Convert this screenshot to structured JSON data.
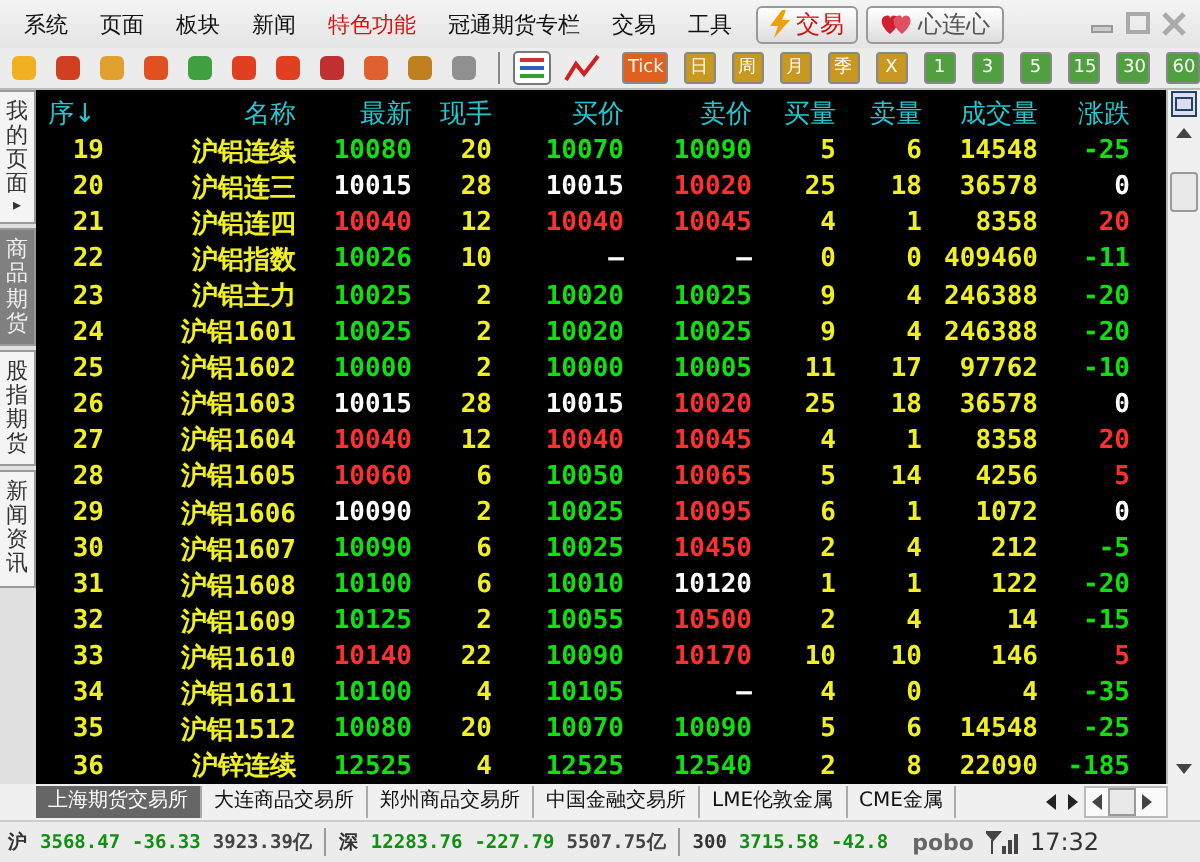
{
  "menu": [
    {
      "label": "系统",
      "highlighted": false
    },
    {
      "label": "页面",
      "highlighted": false
    },
    {
      "label": "板块",
      "highlighted": false
    },
    {
      "label": "新闻",
      "highlighted": false
    },
    {
      "label": "特色功能",
      "highlighted": true
    },
    {
      "label": "冠通期货专栏",
      "highlighted": false
    },
    {
      "label": "交易",
      "highlighted": false
    },
    {
      "label": "工具",
      "highlighted": false
    }
  ],
  "trade_button": "交易",
  "heart_button": "心连心",
  "period_buttons": [
    {
      "label": "Tick",
      "kind": "tick"
    },
    {
      "label": "日",
      "kind": "period"
    },
    {
      "label": "周",
      "kind": "period"
    },
    {
      "label": "月",
      "kind": "period"
    },
    {
      "label": "季",
      "kind": "period"
    },
    {
      "label": "X",
      "kind": "period"
    },
    {
      "label": "1",
      "kind": "minute"
    },
    {
      "label": "3",
      "kind": "minute"
    },
    {
      "label": "5",
      "kind": "minute"
    },
    {
      "label": "15",
      "kind": "minute"
    },
    {
      "label": "30",
      "kind": "minute"
    },
    {
      "label": "60",
      "kind": "minute"
    }
  ],
  "side_tabs": [
    {
      "label": "我的页面",
      "selected": false,
      "arrow": "▸"
    },
    {
      "label": "商品期货",
      "selected": true
    },
    {
      "label": "股指期货",
      "selected": false
    },
    {
      "label": "新闻资讯",
      "selected": false
    }
  ],
  "table": {
    "columns": [
      "序↓",
      "名称",
      "最新",
      "现手",
      "买价",
      "卖价",
      "买量",
      "卖量",
      "成交量",
      "涨跌"
    ],
    "rows": [
      {
        "no": "19",
        "name": "沪铝连续",
        "last": {
          "text": "10080",
          "color": "#10e010"
        },
        "hand": "20",
        "bid": {
          "text": "10070",
          "color": "#10e010"
        },
        "ask": {
          "text": "10090",
          "color": "#10e010"
        },
        "bid_qty": "5",
        "ask_qty": "6",
        "volume": "14548",
        "change": {
          "text": "-25",
          "color": "#10e010"
        }
      },
      {
        "no": "20",
        "name": "沪铝连三",
        "last": {
          "text": "10015",
          "color": "#ffffff"
        },
        "hand": "28",
        "bid": {
          "text": "10015",
          "color": "#ffffff"
        },
        "ask": {
          "text": "10020",
          "color": "#ff3030"
        },
        "bid_qty": "25",
        "ask_qty": "18",
        "volume": "36578",
        "change": {
          "text": "0",
          "color": "#ffffff"
        }
      },
      {
        "no": "21",
        "name": "沪铝连四",
        "last": {
          "text": "10040",
          "color": "#ff3030"
        },
        "hand": "12",
        "bid": {
          "text": "10040",
          "color": "#ff3030"
        },
        "ask": {
          "text": "10045",
          "color": "#ff3030"
        },
        "bid_qty": "4",
        "ask_qty": "1",
        "volume": "8358",
        "change": {
          "text": "20",
          "color": "#ff3030"
        }
      },
      {
        "no": "22",
        "name": "沪铝指数",
        "last": {
          "text": "10026",
          "color": "#10e010"
        },
        "hand": "10",
        "bid": {
          "text": "—",
          "color": "#ffffff"
        },
        "ask": {
          "text": "—",
          "color": "#ffffff"
        },
        "bid_qty": "0",
        "ask_qty": "0",
        "volume": "409460",
        "change": {
          "text": "-11",
          "color": "#10e010"
        }
      },
      {
        "no": "23",
        "name": "沪铝主力",
        "last": {
          "text": "10025",
          "color": "#10e010"
        },
        "hand": "2",
        "bid": {
          "text": "10020",
          "color": "#10e010"
        },
        "ask": {
          "text": "10025",
          "color": "#10e010"
        },
        "bid_qty": "9",
        "ask_qty": "4",
        "volume": "246388",
        "change": {
          "text": "-20",
          "color": "#10e010"
        }
      },
      {
        "no": "24",
        "name": "沪铝1601",
        "last": {
          "text": "10025",
          "color": "#10e010"
        },
        "hand": "2",
        "bid": {
          "text": "10020",
          "color": "#10e010"
        },
        "ask": {
          "text": "10025",
          "color": "#10e010"
        },
        "bid_qty": "9",
        "ask_qty": "4",
        "volume": "246388",
        "change": {
          "text": "-20",
          "color": "#10e010"
        }
      },
      {
        "no": "25",
        "name": "沪铝1602",
        "last": {
          "text": "10000",
          "color": "#10e010"
        },
        "hand": "2",
        "bid": {
          "text": "10000",
          "color": "#10e010"
        },
        "ask": {
          "text": "10005",
          "color": "#10e010"
        },
        "bid_qty": "11",
        "ask_qty": "17",
        "volume": "97762",
        "change": {
          "text": "-10",
          "color": "#10e010"
        }
      },
      {
        "no": "26",
        "name": "沪铝1603",
        "last": {
          "text": "10015",
          "color": "#ffffff"
        },
        "hand": "28",
        "bid": {
          "text": "10015",
          "color": "#ffffff"
        },
        "ask": {
          "text": "10020",
          "color": "#ff3030"
        },
        "bid_qty": "25",
        "ask_qty": "18",
        "volume": "36578",
        "change": {
          "text": "0",
          "color": "#ffffff"
        }
      },
      {
        "no": "27",
        "name": "沪铝1604",
        "last": {
          "text": "10040",
          "color": "#ff3030"
        },
        "hand": "12",
        "bid": {
          "text": "10040",
          "color": "#ff3030"
        },
        "ask": {
          "text": "10045",
          "color": "#ff3030"
        },
        "bid_qty": "4",
        "ask_qty": "1",
        "volume": "8358",
        "change": {
          "text": "20",
          "color": "#ff3030"
        }
      },
      {
        "no": "28",
        "name": "沪铝1605",
        "last": {
          "text": "10060",
          "color": "#ff3030"
        },
        "hand": "6",
        "bid": {
          "text": "10050",
          "color": "#10e010"
        },
        "ask": {
          "text": "10065",
          "color": "#ff3030"
        },
        "bid_qty": "5",
        "ask_qty": "14",
        "volume": "4256",
        "change": {
          "text": "5",
          "color": "#ff3030"
        }
      },
      {
        "no": "29",
        "name": "沪铝1606",
        "last": {
          "text": "10090",
          "color": "#ffffff"
        },
        "hand": "2",
        "bid": {
          "text": "10025",
          "color": "#10e010"
        },
        "ask": {
          "text": "10095",
          "color": "#ff3030"
        },
        "bid_qty": "6",
        "ask_qty": "1",
        "volume": "1072",
        "change": {
          "text": "0",
          "color": "#ffffff"
        }
      },
      {
        "no": "30",
        "name": "沪铝1607",
        "last": {
          "text": "10090",
          "color": "#10e010"
        },
        "hand": "6",
        "bid": {
          "text": "10025",
          "color": "#10e010"
        },
        "ask": {
          "text": "10450",
          "color": "#ff3030"
        },
        "bid_qty": "2",
        "ask_qty": "4",
        "volume": "212",
        "change": {
          "text": "-5",
          "color": "#10e010"
        }
      },
      {
        "no": "31",
        "name": "沪铝1608",
        "last": {
          "text": "10100",
          "color": "#10e010"
        },
        "hand": "6",
        "bid": {
          "text": "10010",
          "color": "#10e010"
        },
        "ask": {
          "text": "10120",
          "color": "#ffffff"
        },
        "bid_qty": "1",
        "ask_qty": "1",
        "volume": "122",
        "change": {
          "text": "-20",
          "color": "#10e010"
        }
      },
      {
        "no": "32",
        "name": "沪铝1609",
        "last": {
          "text": "10125",
          "color": "#10e010"
        },
        "hand": "2",
        "bid": {
          "text": "10055",
          "color": "#10e010"
        },
        "ask": {
          "text": "10500",
          "color": "#ff3030"
        },
        "bid_qty": "2",
        "ask_qty": "4",
        "volume": "14",
        "change": {
          "text": "-15",
          "color": "#10e010"
        }
      },
      {
        "no": "33",
        "name": "沪铝1610",
        "last": {
          "text": "10140",
          "color": "#ff3030"
        },
        "hand": "22",
        "bid": {
          "text": "10090",
          "color": "#10e010"
        },
        "ask": {
          "text": "10170",
          "color": "#ff3030"
        },
        "bid_qty": "10",
        "ask_qty": "10",
        "volume": "146",
        "change": {
          "text": "5",
          "color": "#ff3030"
        }
      },
      {
        "no": "34",
        "name": "沪铝1611",
        "last": {
          "text": "10100",
          "color": "#10e010"
        },
        "hand": "4",
        "bid": {
          "text": "10105",
          "color": "#10e010"
        },
        "ask": {
          "text": "—",
          "color": "#ffffff"
        },
        "bid_qty": "4",
        "ask_qty": "0",
        "volume": "4",
        "change": {
          "text": "-35",
          "color": "#10e010"
        }
      },
      {
        "no": "35",
        "name": "沪铝1512",
        "last": {
          "text": "10080",
          "color": "#10e010"
        },
        "hand": "20",
        "bid": {
          "text": "10070",
          "color": "#10e010"
        },
        "ask": {
          "text": "10090",
          "color": "#10e010"
        },
        "bid_qty": "5",
        "ask_qty": "6",
        "volume": "14548",
        "change": {
          "text": "-25",
          "color": "#10e010"
        }
      },
      {
        "no": "36",
        "name": "沪锌连续",
        "last": {
          "text": "12525",
          "color": "#10e010"
        },
        "hand": "4",
        "bid": {
          "text": "12525",
          "color": "#10e010"
        },
        "ask": {
          "text": "12540",
          "color": "#10e010"
        },
        "bid_qty": "2",
        "ask_qty": "8",
        "volume": "22090",
        "change": {
          "text": "-185",
          "color": "#10e010"
        }
      }
    ]
  },
  "exchange_tabs": [
    {
      "label": "上海期货交易所",
      "selected": true
    },
    {
      "label": "大连商品交易所",
      "selected": false
    },
    {
      "label": "郑州商品交易所",
      "selected": false
    },
    {
      "label": "中国金融交易所",
      "selected": false
    },
    {
      "label": "LME伦敦金属",
      "selected": false
    },
    {
      "label": "CME金属",
      "selected": false
    }
  ],
  "status_bar": {
    "indices": [
      {
        "label": "沪",
        "value": "3568.47",
        "change": "-36.33",
        "amount": "3923.39亿"
      },
      {
        "label": "深",
        "value": "12283.76",
        "change": "-227.79",
        "amount": "5507.75亿"
      },
      {
        "label": "300",
        "value": "3715.58",
        "change": "-42.8"
      }
    ],
    "brand": "pobo",
    "time": "17:32"
  }
}
